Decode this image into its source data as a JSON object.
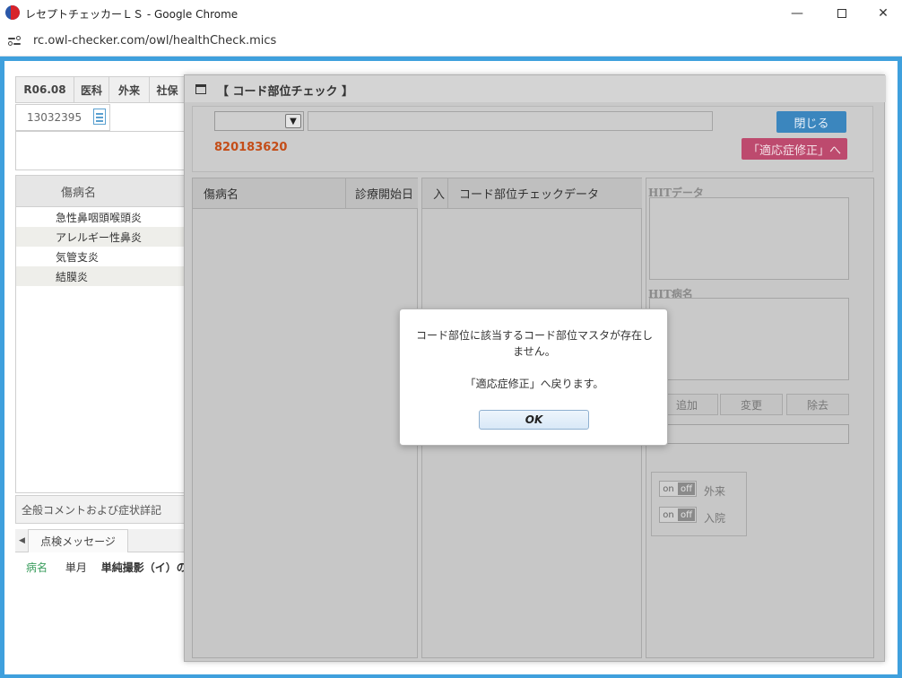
{
  "window": {
    "title": "レセプトチェッカーＬＳ - Google Chrome",
    "url": "rc.owl-checker.com/owl/healthCheck.mics"
  },
  "background": {
    "header_cells": [
      "R06.08",
      "医科",
      "外来",
      "社保"
    ],
    "patient_id": "13032395",
    "disease_header": "傷病名",
    "diseases": [
      "急性鼻咽頭喉頭炎",
      "アレルギー性鼻炎",
      "気管支炎",
      "結膜炎"
    ],
    "comment_label": "全般コメントおよび症状詳記",
    "tab_label": "点検メッセージ",
    "message": {
      "category": "病名",
      "period": "単月",
      "text": "単純撮影（イ）の"
    }
  },
  "modal": {
    "title": "【 コード部位チェック 】",
    "code": "820183620",
    "close_label": "閉じる",
    "tekiou_label": "「適応症修正」へ",
    "left_cols": [
      "傷病名",
      "診療開始日"
    ],
    "mid_cols": [
      "入",
      "コード部位チェックデータ"
    ],
    "hit_data_label": "HITデータ",
    "hit_disease_label": "HIT病名",
    "add_label": "追加",
    "change_label": "変更",
    "delete_label": "除去",
    "toggle_on": "on",
    "toggle_off": "off",
    "outpatient_label": "外来",
    "inpatient_label": "入院"
  },
  "dialog": {
    "line1": "コード部位に該当するコード部位マスタが存在しません。",
    "line2": "「適応症修正」へ戻ります。",
    "ok_label": "OK"
  },
  "colors": {
    "frame": "#3fa0dd",
    "close_button": "#3b86be",
    "tekiou_button": "#bd4a6e",
    "code_text": "#c44d18"
  }
}
